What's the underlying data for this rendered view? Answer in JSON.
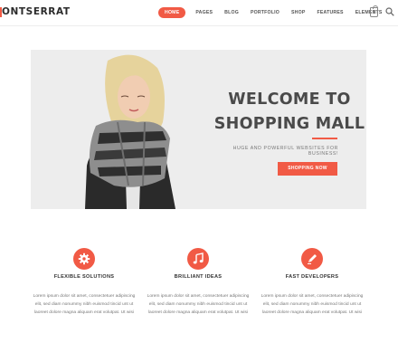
{
  "header": {
    "logo": "ONTSERRAT",
    "nav": [
      "HOME",
      "PAGES",
      "BLOG",
      "PORTFOLIO",
      "SHOP",
      "FEATURES",
      "ELEMENTS"
    ],
    "cart_count": "0"
  },
  "hero": {
    "title_line1": "WELCOME TO",
    "title_line2": "SHOPPING MALL",
    "subtitle": "HUGE AND POWERFUL WEBSITES FOR BUSINESS!",
    "button": "SHOPPING NOW"
  },
  "features": [
    {
      "icon": "gear-icon",
      "title": "FLEXIBLE SOLUTIONS",
      "text1": "Lorem ipsum dolor sit amet, consectetuer adipiscing",
      "text2": "elit, sed diam nonummy nibh euismod tincid unt ut",
      "text3": "laoreet dolore magna aliquam erat volutpat. Ut wisi"
    },
    {
      "icon": "music-note-icon",
      "title": "BRILLIANT IDEAS",
      "text1": "Lorem ipsum dolor sit amet, consectetuer adipiscing",
      "text2": "elit, sed diam nonummy nibh euismod tincid unt ut",
      "text3": "laoreet dolore magna aliquam erat volutpat. Ut wisi"
    },
    {
      "icon": "pencil-icon",
      "title": "FAST DEVELOPERS",
      "text1": "Lorem ipsum dolor sit amet, consectetuer adipiscing",
      "text2": "elit, sed diam nonummy nibh euismod tincid unt ut",
      "text3": "laoreet dolore magna aliquam erat volutpat. Ut wisi"
    }
  ],
  "colors": {
    "accent": "#f15a45",
    "hero_bg": "#ededed",
    "heading": "#4a4a4a"
  }
}
